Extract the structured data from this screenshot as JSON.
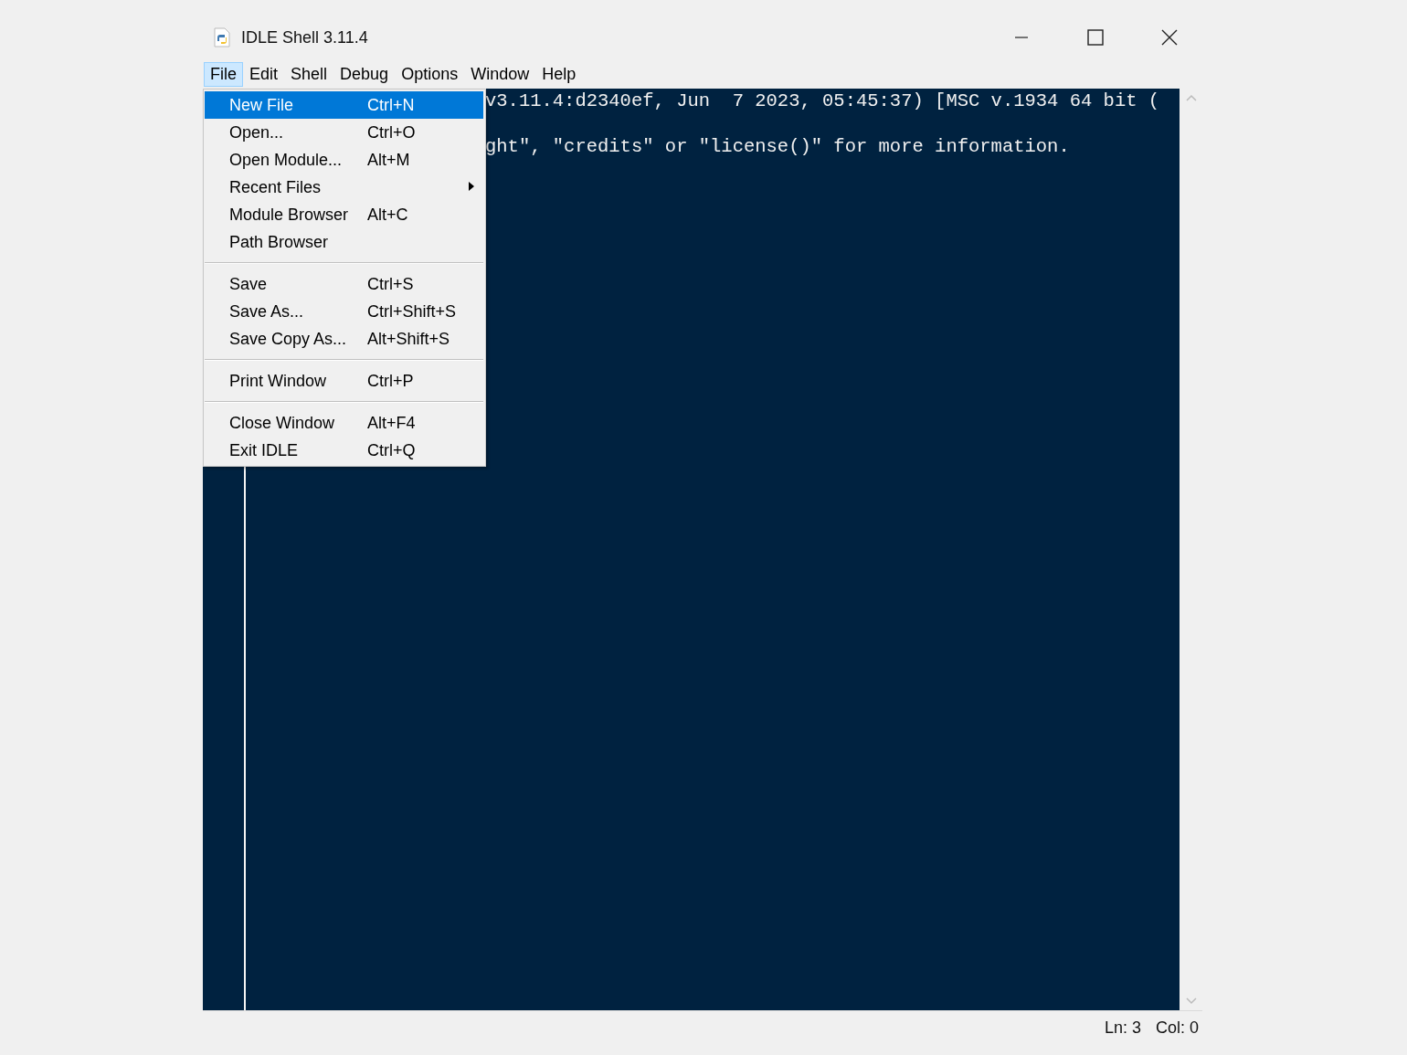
{
  "window": {
    "title": "IDLE Shell 3.11.4"
  },
  "menubar": [
    {
      "label": "File",
      "selected": true
    },
    {
      "label": "Edit",
      "selected": false
    },
    {
      "label": "Shell",
      "selected": false
    },
    {
      "label": "Debug",
      "selected": false
    },
    {
      "label": "Options",
      "selected": false
    },
    {
      "label": "Window",
      "selected": false
    },
    {
      "label": "Help",
      "selected": false
    }
  ],
  "file_menu": {
    "items": [
      {
        "kind": "item",
        "label": "New File",
        "shortcut": "Ctrl+N",
        "selected": true
      },
      {
        "kind": "item",
        "label": "Open...",
        "shortcut": "Ctrl+O",
        "selected": false
      },
      {
        "kind": "item",
        "label": "Open Module...",
        "shortcut": "Alt+M",
        "selected": false
      },
      {
        "kind": "submenu",
        "label": "Recent Files",
        "selected": false
      },
      {
        "kind": "item",
        "label": "Module Browser",
        "shortcut": "Alt+C",
        "selected": false
      },
      {
        "kind": "item",
        "label": "Path Browser",
        "selected": false
      },
      {
        "kind": "separator"
      },
      {
        "kind": "item",
        "label": "Save",
        "shortcut": "Ctrl+S",
        "selected": false
      },
      {
        "kind": "item",
        "label": "Save As...",
        "shortcut": "Ctrl+Shift+S",
        "selected": false
      },
      {
        "kind": "item",
        "label": "Save Copy As...",
        "shortcut": "Alt+Shift+S",
        "selected": false
      },
      {
        "kind": "separator"
      },
      {
        "kind": "item",
        "label": "Print Window",
        "shortcut": "Ctrl+P",
        "selected": false
      },
      {
        "kind": "separator"
      },
      {
        "kind": "item",
        "label": "Close Window",
        "shortcut": "Alt+F4",
        "selected": false
      },
      {
        "kind": "item",
        "label": "Exit IDLE",
        "shortcut": "Ctrl+Q",
        "selected": false
      }
    ]
  },
  "shell": {
    "lines": [
      "v3.11.4:d2340ef, Jun  7 2023, 05:45:37) [MSC v.1934 64 bit (",
      "ght\", \"credits\" or \"license()\" for more information."
    ]
  },
  "status_bar": {
    "line": "Ln: 3",
    "column": "Col: 0"
  }
}
